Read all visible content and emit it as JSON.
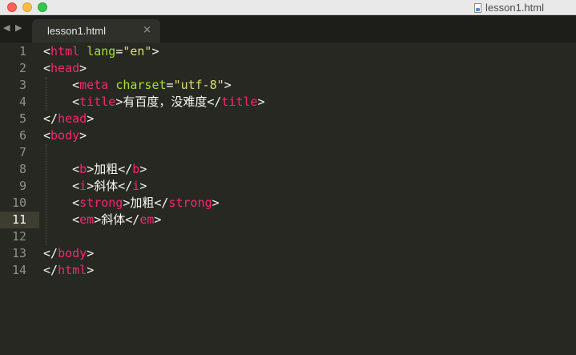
{
  "window": {
    "title": "lesson1.html"
  },
  "tabs": [
    {
      "label": "lesson1.html",
      "close_glyph": "×"
    }
  ],
  "nav": {
    "back": "◀",
    "forward": "▶"
  },
  "editor": {
    "line_numbers": [
      "1",
      "2",
      "3",
      "4",
      "5",
      "6",
      "7",
      "8",
      "9",
      "10",
      "11",
      "12",
      "13",
      "14"
    ],
    "active_line": "11",
    "tags": {
      "html": "html",
      "head": "head",
      "meta": "meta",
      "title": "title",
      "body": "body",
      "b": "b",
      "i": "i",
      "strong": "strong",
      "em": "em"
    },
    "attrs": {
      "lang": "lang",
      "lang_value": "\"en\"",
      "charset": "charset",
      "charset_value": "\"utf-8\""
    },
    "text": {
      "title": "有百度，没难度",
      "bold": "加粗",
      "italic": "斜体",
      "strong": "加粗",
      "em": "斜体"
    }
  },
  "colors": {
    "background": "#272822",
    "tag": "#f92672",
    "attribute": "#a6e22e",
    "string": "#e6db74",
    "plain": "#f8f8f2",
    "line_number": "#8f908a"
  }
}
